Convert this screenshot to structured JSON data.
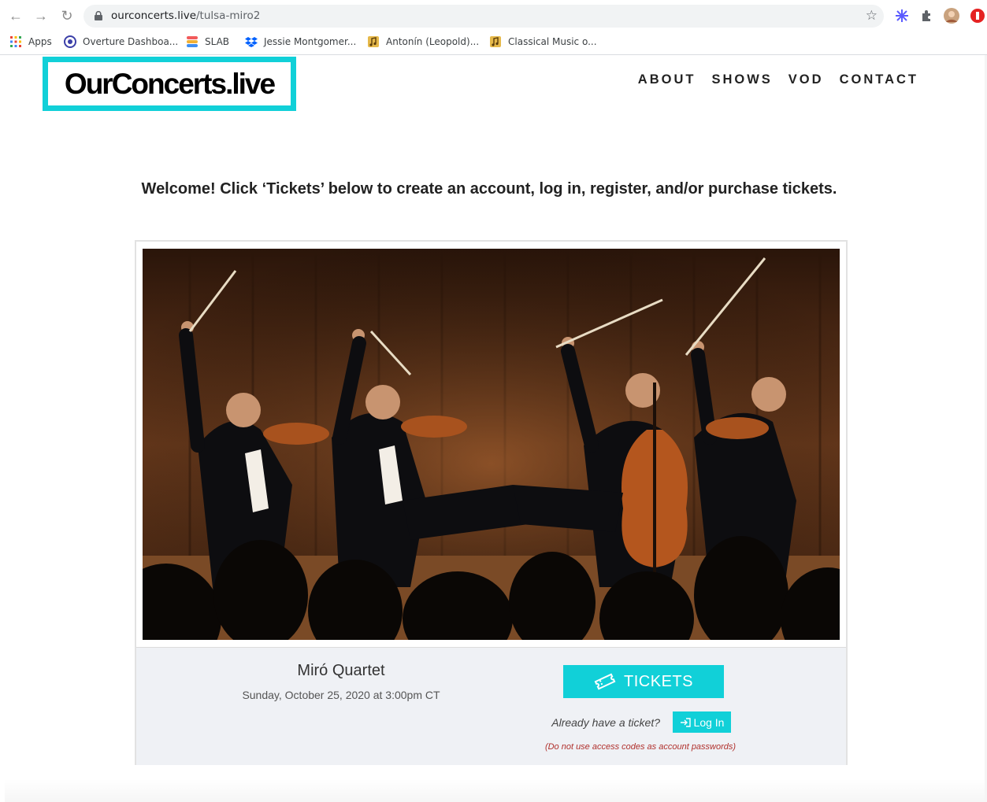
{
  "browser": {
    "url_host": "ourconcerts.live",
    "url_path": "/tulsa-miro2",
    "bookmarks": [
      {
        "label": "Apps",
        "icon": "apps-grid-icon"
      },
      {
        "label": "Overture Dashboa...",
        "icon": "overture-icon"
      },
      {
        "label": "SLAB",
        "icon": "slab-icon"
      },
      {
        "label": "Jessie Montgomer...",
        "icon": "dropbox-icon"
      },
      {
        "label": "Antonín (Leopold)...",
        "icon": "music-folder-icon"
      },
      {
        "label": "Classical Music o...",
        "icon": "music-folder-icon"
      }
    ]
  },
  "site": {
    "logo_text": "OurConcerts.live",
    "nav": [
      "ABOUT",
      "SHOWS",
      "VOD",
      "CONTACT"
    ],
    "brand_color": "#11d0d8"
  },
  "main": {
    "welcome": "Welcome! Click ‘Tickets’ below to create an account, log in, register, and/or purchase tickets."
  },
  "event": {
    "title": "Miró Quartet",
    "datetime": "Sunday, October 25, 2020 at 3:00pm CT",
    "tickets_label": "TICKETS",
    "already_label": "Already have a ticket?",
    "login_label": "Log In",
    "note": "(Do not use access codes as account passwords)"
  }
}
